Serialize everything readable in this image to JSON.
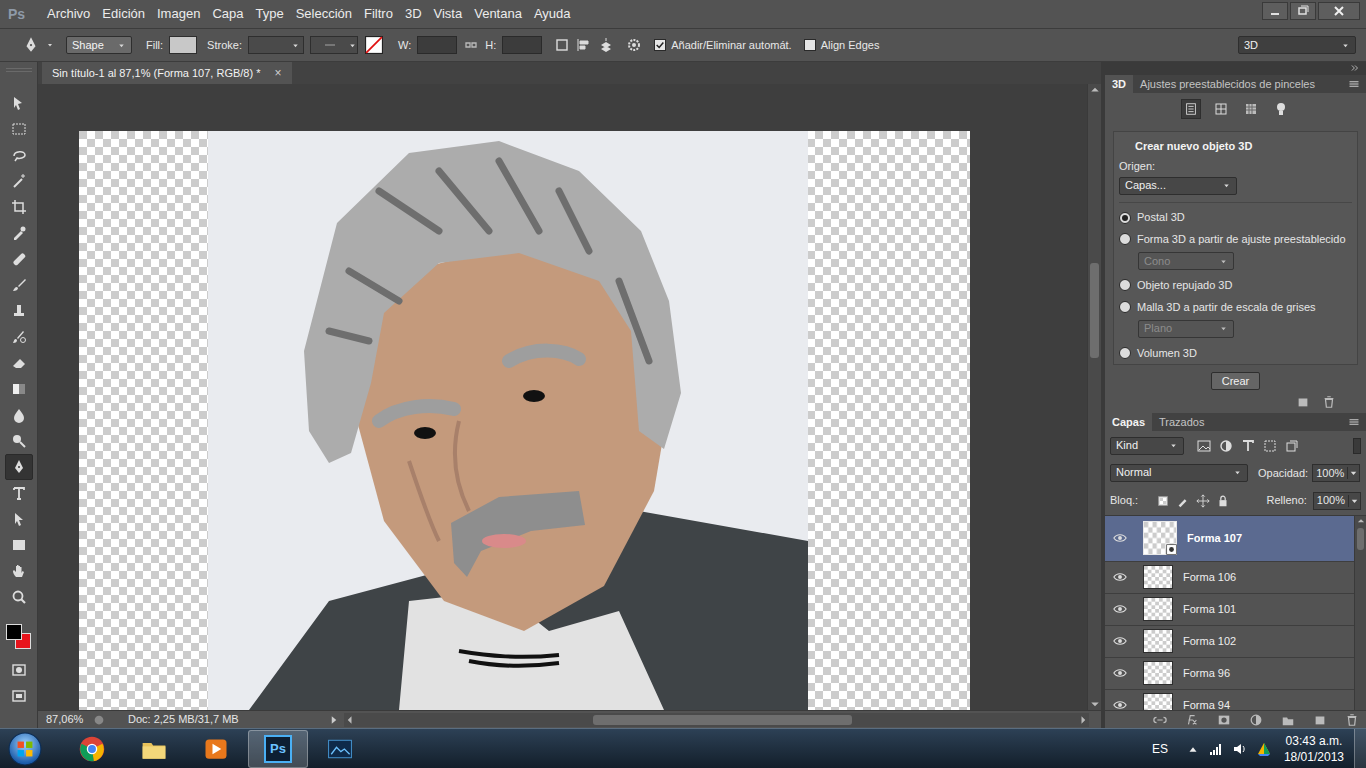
{
  "app": {
    "logo": "Ps"
  },
  "menu": [
    "Archivo",
    "Edición",
    "Imagen",
    "Capa",
    "Type",
    "Selección",
    "Filtro",
    "3D",
    "Vista",
    "Ventana",
    "Ayuda"
  ],
  "options_bar": {
    "mode": "Shape",
    "fill_label": "Fill:",
    "stroke_label": "Stroke:",
    "w_label": "W:",
    "h_label": "H:",
    "checkboxes": [
      {
        "label": "Añadir/Eliminar automát.",
        "checked": true
      },
      {
        "label": "Align Edges",
        "checked": false
      }
    ],
    "workspace": "3D"
  },
  "document_tab": {
    "title": "Sin título-1 al 87,1% (Forma 107, RGB/8) *",
    "close": "×"
  },
  "tools": [
    {
      "selected": false
    },
    {
      "selected": false
    },
    {
      "selected": false
    },
    {
      "selected": false
    },
    {
      "selected": false
    },
    {
      "selected": false
    },
    {
      "selected": false
    },
    {
      "selected": false
    },
    {
      "selected": false
    },
    {
      "selected": false
    },
    {
      "selected": false
    },
    {
      "selected": false
    },
    {
      "selected": false
    },
    {
      "selected": false
    },
    {
      "selected": true
    },
    {
      "selected": false
    },
    {
      "selected": false
    },
    {
      "selected": false
    },
    {
      "selected": false
    },
    {
      "selected": false
    }
  ],
  "swatches": {
    "foreground": "#000000",
    "background": "#e8141c"
  },
  "status_bar": {
    "zoom": "87,06%",
    "doc_size": "Doc: 2,25 MB/31,7 MB"
  },
  "panel_3d": {
    "tabs": [
      {
        "label": "3D",
        "selected": true
      },
      {
        "label": "Ajustes preestablecidos de pinceles",
        "selected": false
      }
    ],
    "title": "Crear nuevo objeto 3D",
    "origin_label": "Origen:",
    "origin": "Capas...",
    "options": [
      {
        "label": "Postal 3D",
        "selected": true
      },
      {
        "label": "Forma 3D a partir de ajuste preestablecido",
        "selected": false,
        "preset": {
          "label": "Cono",
          "disabled": true
        }
      },
      {
        "label": "Objeto repujado 3D",
        "selected": false
      },
      {
        "label": "Malla 3D a partir de escala de grises",
        "selected": false,
        "preset": {
          "label": "Plano",
          "disabled": true
        }
      },
      {
        "label": "Volumen 3D",
        "selected": false
      }
    ],
    "button": "Crear"
  },
  "layers_panel": {
    "tabs": [
      {
        "label": "Capas",
        "selected": true
      },
      {
        "label": "Trazados",
        "selected": false
      }
    ],
    "filter": "Kind",
    "blend": "Normal",
    "opacity_label": "Opacidad:",
    "opacity": "100%",
    "lock_label": "Bloq.:",
    "fill_label": "Relleno:",
    "fill": "100%",
    "layers": [
      {
        "name": "Forma 107",
        "selected": true,
        "visible": true
      },
      {
        "name": "Forma 106",
        "selected": false,
        "visible": true
      },
      {
        "name": "Forma 101",
        "selected": false,
        "visible": true
      },
      {
        "name": "Forma 102",
        "selected": false,
        "visible": true
      },
      {
        "name": "Forma 96",
        "selected": false,
        "visible": true
      },
      {
        "name": "Forma 94",
        "selected": false,
        "visible": true
      }
    ]
  },
  "taskbar": {
    "ps_label": "Ps",
    "language": "ES",
    "time": "03:43 a.m.",
    "date": "18/01/2013"
  }
}
